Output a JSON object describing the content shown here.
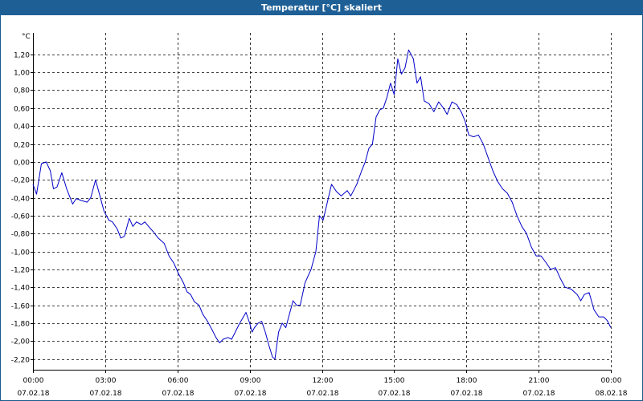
{
  "window": {
    "title": "Temperatur [°C] skaliert",
    "title_bar_color": "#1e5f96"
  },
  "chart_data": {
    "type": "line",
    "title": "Temperatur [°C] skaliert",
    "ylabel": "°C",
    "xlabel": "",
    "ylim": [
      -2.32,
      1.44
    ],
    "xlim_hours": [
      0,
      24
    ],
    "grid": true,
    "line_color": "#0000c8",
    "y_ticks": [
      {
        "value": 1.2,
        "label": "1,20"
      },
      {
        "value": 1.0,
        "label": "1,00"
      },
      {
        "value": 0.8,
        "label": "0,80"
      },
      {
        "value": 0.6,
        "label": "0,60"
      },
      {
        "value": 0.4,
        "label": "0,40"
      },
      {
        "value": 0.2,
        "label": "0,20"
      },
      {
        "value": 0.0,
        "label": "0,00"
      },
      {
        "value": -0.2,
        "label": "-0,20"
      },
      {
        "value": -0.4,
        "label": "-0,40"
      },
      {
        "value": -0.6,
        "label": "-0,60"
      },
      {
        "value": -0.8,
        "label": "-0,80"
      },
      {
        "value": -1.0,
        "label": "-1,00"
      },
      {
        "value": -1.2,
        "label": "-1,20"
      },
      {
        "value": -1.4,
        "label": "-1,40"
      },
      {
        "value": -1.6,
        "label": "-1,60"
      },
      {
        "value": -1.8,
        "label": "-1,80"
      },
      {
        "value": -2.0,
        "label": "-2,00"
      },
      {
        "value": -2.2,
        "label": "-2,20"
      }
    ],
    "x_ticks": [
      {
        "hour": 0,
        "time": "00:00",
        "date": "07.02.18"
      },
      {
        "hour": 3,
        "time": "03:00",
        "date": "07.02.18"
      },
      {
        "hour": 6,
        "time": "06:00",
        "date": "07.02.18"
      },
      {
        "hour": 9,
        "time": "09:00",
        "date": "07.02.18"
      },
      {
        "hour": 12,
        "time": "12:00",
        "date": "07.02.18"
      },
      {
        "hour": 15,
        "time": "15:00",
        "date": "07.02.18"
      },
      {
        "hour": 18,
        "time": "18:00",
        "date": "07.02.18"
      },
      {
        "hour": 21,
        "time": "21:00",
        "date": "07.02.18"
      },
      {
        "hour": 24,
        "time": "00:00",
        "date": "08.02.18"
      }
    ],
    "series": [
      {
        "points": [
          [
            0.0,
            -0.25
          ],
          [
            0.15,
            -0.36
          ],
          [
            0.35,
            -0.02
          ],
          [
            0.55,
            0.0
          ],
          [
            0.72,
            -0.1
          ],
          [
            0.85,
            -0.3
          ],
          [
            1.0,
            -0.28
          ],
          [
            1.2,
            -0.12
          ],
          [
            1.4,
            -0.3
          ],
          [
            1.65,
            -0.47
          ],
          [
            1.8,
            -0.41
          ],
          [
            2.0,
            -0.43
          ],
          [
            2.25,
            -0.45
          ],
          [
            2.4,
            -0.4
          ],
          [
            2.6,
            -0.2
          ],
          [
            2.75,
            -0.35
          ],
          [
            2.95,
            -0.55
          ],
          [
            3.15,
            -0.65
          ],
          [
            3.3,
            -0.67
          ],
          [
            3.5,
            -0.75
          ],
          [
            3.65,
            -0.85
          ],
          [
            3.8,
            -0.83
          ],
          [
            4.0,
            -0.63
          ],
          [
            4.15,
            -0.72
          ],
          [
            4.3,
            -0.67
          ],
          [
            4.5,
            -0.7
          ],
          [
            4.65,
            -0.67
          ],
          [
            4.8,
            -0.72
          ],
          [
            5.0,
            -0.78
          ],
          [
            5.2,
            -0.85
          ],
          [
            5.45,
            -0.91
          ],
          [
            5.65,
            -1.05
          ],
          [
            5.85,
            -1.13
          ],
          [
            6.05,
            -1.25
          ],
          [
            6.25,
            -1.35
          ],
          [
            6.4,
            -1.45
          ],
          [
            6.55,
            -1.48
          ],
          [
            6.7,
            -1.56
          ],
          [
            6.9,
            -1.6
          ],
          [
            7.05,
            -1.7
          ],
          [
            7.25,
            -1.78
          ],
          [
            7.45,
            -1.88
          ],
          [
            7.6,
            -1.96
          ],
          [
            7.75,
            -2.02
          ],
          [
            7.9,
            -1.98
          ],
          [
            8.1,
            -1.96
          ],
          [
            8.25,
            -1.98
          ],
          [
            8.4,
            -1.9
          ],
          [
            8.55,
            -1.82
          ],
          [
            8.7,
            -1.75
          ],
          [
            8.85,
            -1.68
          ],
          [
            9.0,
            -1.8
          ],
          [
            9.1,
            -1.9
          ],
          [
            9.2,
            -1.85
          ],
          [
            9.35,
            -1.8
          ],
          [
            9.5,
            -1.78
          ],
          [
            9.65,
            -1.9
          ],
          [
            9.8,
            -2.05
          ],
          [
            9.95,
            -2.18
          ],
          [
            10.05,
            -2.2
          ],
          [
            10.2,
            -1.9
          ],
          [
            10.35,
            -1.8
          ],
          [
            10.5,
            -1.85
          ],
          [
            10.65,
            -1.7
          ],
          [
            10.8,
            -1.55
          ],
          [
            10.95,
            -1.6
          ],
          [
            11.1,
            -1.6
          ],
          [
            11.3,
            -1.35
          ],
          [
            11.55,
            -1.2
          ],
          [
            11.75,
            -1.0
          ],
          [
            11.9,
            -0.6
          ],
          [
            12.05,
            -0.65
          ],
          [
            12.2,
            -0.48
          ],
          [
            12.4,
            -0.25
          ],
          [
            12.6,
            -0.33
          ],
          [
            12.8,
            -0.38
          ],
          [
            13.05,
            -0.32
          ],
          [
            13.2,
            -0.38
          ],
          [
            13.45,
            -0.25
          ],
          [
            13.65,
            -0.1
          ],
          [
            13.8,
            0.0
          ],
          [
            13.95,
            0.15
          ],
          [
            14.1,
            0.2
          ],
          [
            14.25,
            0.5
          ],
          [
            14.4,
            0.58
          ],
          [
            14.55,
            0.6
          ],
          [
            14.7,
            0.72
          ],
          [
            14.85,
            0.88
          ],
          [
            15.0,
            0.75
          ],
          [
            15.15,
            1.15
          ],
          [
            15.3,
            0.98
          ],
          [
            15.45,
            1.05
          ],
          [
            15.6,
            1.25
          ],
          [
            15.8,
            1.15
          ],
          [
            15.95,
            0.88
          ],
          [
            16.1,
            0.95
          ],
          [
            16.25,
            0.68
          ],
          [
            16.45,
            0.65
          ],
          [
            16.65,
            0.56
          ],
          [
            16.85,
            0.67
          ],
          [
            17.05,
            0.6
          ],
          [
            17.2,
            0.53
          ],
          [
            17.4,
            0.67
          ],
          [
            17.6,
            0.64
          ],
          [
            17.8,
            0.55
          ],
          [
            17.95,
            0.45
          ],
          [
            18.1,
            0.3
          ],
          [
            18.3,
            0.28
          ],
          [
            18.5,
            0.3
          ],
          [
            18.7,
            0.2
          ],
          [
            18.9,
            0.05
          ],
          [
            19.1,
            -0.1
          ],
          [
            19.3,
            -0.22
          ],
          [
            19.5,
            -0.3
          ],
          [
            19.7,
            -0.35
          ],
          [
            19.9,
            -0.45
          ],
          [
            20.1,
            -0.6
          ],
          [
            20.3,
            -0.72
          ],
          [
            20.5,
            -0.8
          ],
          [
            20.7,
            -0.95
          ],
          [
            20.9,
            -1.05
          ],
          [
            21.1,
            -1.05
          ],
          [
            21.3,
            -1.12
          ],
          [
            21.5,
            -1.2
          ],
          [
            21.7,
            -1.18
          ],
          [
            21.9,
            -1.3
          ],
          [
            22.1,
            -1.4
          ],
          [
            22.35,
            -1.42
          ],
          [
            22.6,
            -1.48
          ],
          [
            22.75,
            -1.55
          ],
          [
            22.9,
            -1.48
          ],
          [
            23.1,
            -1.46
          ],
          [
            23.3,
            -1.65
          ],
          [
            23.5,
            -1.73
          ],
          [
            23.7,
            -1.73
          ],
          [
            23.85,
            -1.77
          ],
          [
            24.0,
            -1.85
          ]
        ]
      }
    ]
  }
}
